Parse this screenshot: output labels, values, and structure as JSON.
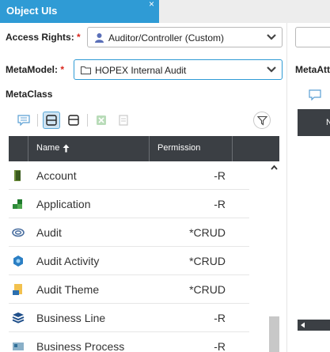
{
  "tab": {
    "title": "Object UIs",
    "close_glyph": "×"
  },
  "access_rights": {
    "label": "Access Rights:",
    "required": "*",
    "value": "Auditor/Controller (Custom)"
  },
  "metamodel": {
    "label": "MetaModel:",
    "required": "*",
    "value": "HOPEX Internal Audit"
  },
  "metaclass_label": "MetaClass",
  "right_panel": {
    "label": "MetaAtt",
    "col_header": "N"
  },
  "table": {
    "col_name": "Name",
    "col_permission": "Permission",
    "rows": [
      {
        "name": "Account",
        "permission": "-R",
        "icon": "account-icon"
      },
      {
        "name": "Application",
        "permission": "-R",
        "icon": "application-icon"
      },
      {
        "name": "Audit",
        "permission": "*CRUD",
        "icon": "audit-icon"
      },
      {
        "name": "Audit Activity",
        "permission": "*CRUD",
        "icon": "audit-activity-icon"
      },
      {
        "name": "Audit Theme",
        "permission": "*CRUD",
        "icon": "audit-theme-icon"
      },
      {
        "name": "Business Line",
        "permission": "-R",
        "icon": "business-line-icon"
      },
      {
        "name": "Business Process",
        "permission": "-R",
        "icon": "business-process-icon"
      }
    ]
  },
  "colors": {
    "accent": "#2f9bd5",
    "header_dark": "#3b3f44",
    "required": "#d9261c"
  }
}
